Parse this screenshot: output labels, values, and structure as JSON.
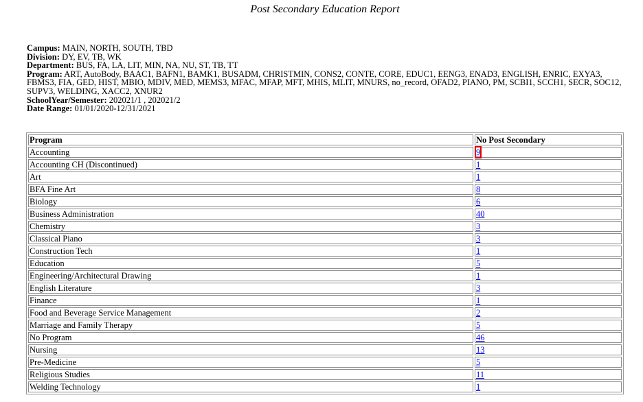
{
  "report": {
    "title": "Post Secondary Education Report"
  },
  "criteria": [
    {
      "label": "Campus:",
      "value": " MAIN, NORTH, SOUTH, TBD"
    },
    {
      "label": "Division:",
      "value": " DY, EV, TB, WK"
    },
    {
      "label": "Department:",
      "value": " BUS, FA, LA, LIT, MIN, NA, NU, ST, TB, TT"
    },
    {
      "label": "Program:",
      "value": " ART, AutoBody, BAAC1, BAFN1, BAMK1, BUSADM, CHRISTMIN, CONS2, CONTE, CORE, EDUC1, EENG3, ENAD3, ENGLISH, ENRIC, EXYA3, FBMS3, FIA, GED, HIST, MBIO, MDIV, MED, MEMS3, MFAC, MFAP, MFT, MHIS, MLIT, MNURS, no_record, OFAD2, PIANO, PM, SCBI1, SCCH1, SECR, SOC12, SUPV3, WELDING, XACC2, XNUR2"
    },
    {
      "label": "SchoolYear/Semester:",
      "value": " 202021/1 , 202021/2"
    },
    {
      "label": "Date Range:",
      "value": " 01/01/2020-12/31/2021"
    }
  ],
  "table": {
    "headers": [
      "Program",
      "No Post Secondary"
    ],
    "rows": [
      {
        "program": "Accounting",
        "count": "9"
      },
      {
        "program": "Accounting CH (Discontinued)",
        "count": "1"
      },
      {
        "program": "Art",
        "count": "1"
      },
      {
        "program": "BFA Fine Art",
        "count": "8"
      },
      {
        "program": "Biology",
        "count": "6"
      },
      {
        "program": "Business Administration",
        "count": "40"
      },
      {
        "program": "Chemistry",
        "count": "3"
      },
      {
        "program": "Classical Piano",
        "count": "3"
      },
      {
        "program": "Construction Tech",
        "count": "1"
      },
      {
        "program": "Education",
        "count": "5"
      },
      {
        "program": "Engineering/Architectural Drawing",
        "count": "1"
      },
      {
        "program": "English Literature",
        "count": "3"
      },
      {
        "program": "Finance",
        "count": "1"
      },
      {
        "program": "Food and Beverage Service Management",
        "count": "2"
      },
      {
        "program": "Marriage and Family Therapy",
        "count": "5"
      },
      {
        "program": "No Program",
        "count": "46"
      },
      {
        "program": "Nursing",
        "count": "13"
      },
      {
        "program": "Pre-Medicine",
        "count": "5"
      },
      {
        "program": "Religious Studies",
        "count": "11"
      },
      {
        "program": "Welding Technology",
        "count": "1"
      }
    ],
    "focused_row": 0
  },
  "colors": {
    "link": "#0000ee",
    "focus_outline": "#e00000"
  }
}
